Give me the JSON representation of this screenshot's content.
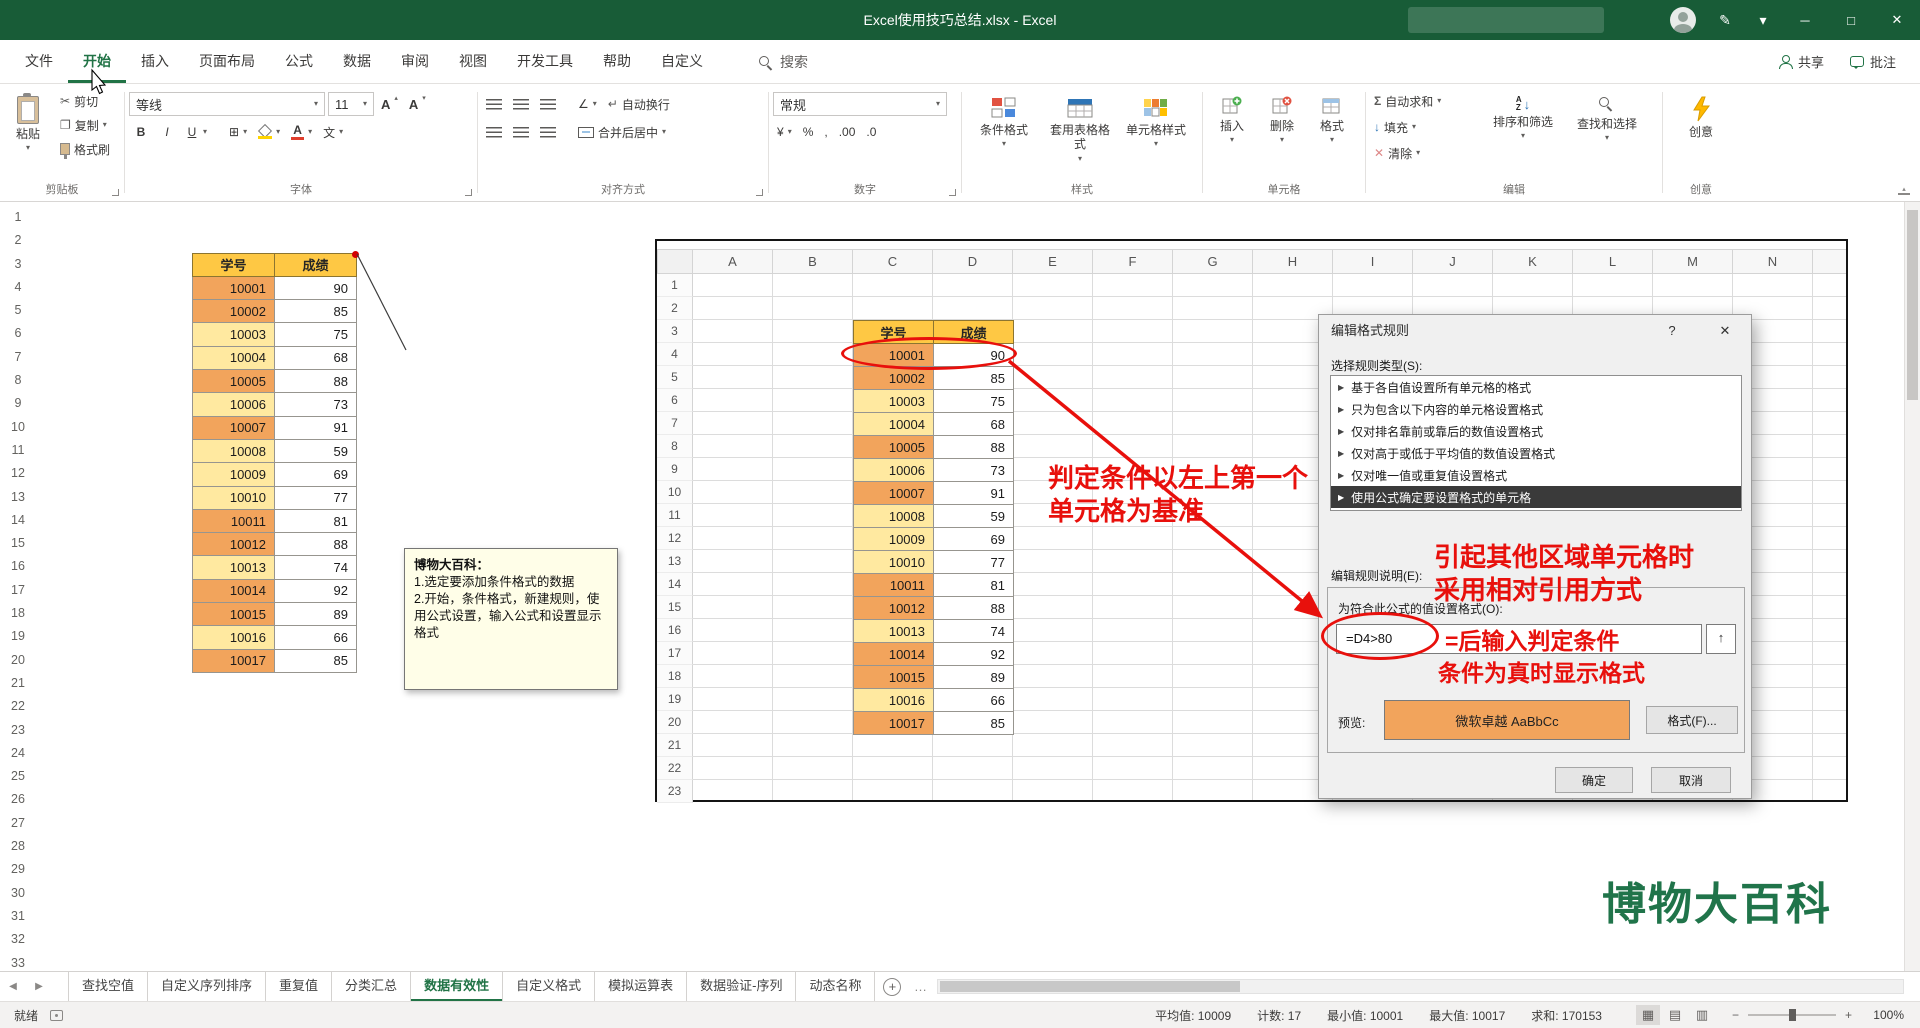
{
  "titlebar": {
    "title": "Excel使用技巧总结.xlsx - Excel"
  },
  "tabs": {
    "items": [
      "文件",
      "开始",
      "插入",
      "页面布局",
      "公式",
      "数据",
      "审阅",
      "视图",
      "开发工具",
      "帮助",
      "自定义"
    ],
    "active": "开始",
    "search_label": "搜索",
    "share_label": "共享",
    "comments_label": "批注"
  },
  "ribbon": {
    "clipboard": {
      "label": "剪贴板",
      "paste": "粘贴",
      "cut": "剪切",
      "copy": "复制",
      "format_painter": "格式刷"
    },
    "font": {
      "label": "字体",
      "font_name": "等线",
      "font_size": "11"
    },
    "alignment": {
      "label": "对齐方式",
      "wrap_text": "自动换行",
      "merge_center": "合并后居中"
    },
    "number": {
      "label": "数字",
      "format": "常规"
    },
    "styles": {
      "label": "样式",
      "conditional": "条件格式",
      "format_as_table": "套用表格格式",
      "cell_styles": "单元格样式"
    },
    "cells": {
      "label": "单元格",
      "insert": "插入",
      "delete": "删除",
      "format": "格式"
    },
    "editing": {
      "label": "编辑",
      "autosum": "自动求和",
      "fill": "填充",
      "clear": "清除",
      "sort_filter": "排序和筛选",
      "find_select": "查找和选择"
    },
    "ideas": {
      "label": "创意",
      "ideas": "创意"
    }
  },
  "sheet": {
    "rows_visible": 33,
    "table": {
      "headers": [
        "学号",
        "成绩"
      ],
      "data": [
        [
          10001,
          90
        ],
        [
          10002,
          85
        ],
        [
          10003,
          75
        ],
        [
          10004,
          68
        ],
        [
          10005,
          88
        ],
        [
          10006,
          73
        ],
        [
          10007,
          91
        ],
        [
          10008,
          59
        ],
        [
          10009,
          69
        ],
        [
          10010,
          77
        ],
        [
          10011,
          81
        ],
        [
          10012,
          88
        ],
        [
          10013,
          74
        ],
        [
          10014,
          92
        ],
        [
          10015,
          89
        ],
        [
          10016,
          66
        ],
        [
          10017,
          85
        ]
      ],
      "highlight_threshold": 80
    },
    "comment": {
      "title": "博物大百科：",
      "lines": [
        "1.选定要添加条件格式的数据",
        "2.开始，条件格式，新建规则，使用公式设置，输入公式和设置显示格式"
      ]
    }
  },
  "embedded_image": {
    "columns": [
      "A",
      "B",
      "C",
      "D",
      "E",
      "F",
      "G",
      "H",
      "I",
      "J",
      "K",
      "L",
      "M",
      "N"
    ],
    "rows_visible": 23
  },
  "dialog": {
    "title": "编辑格式规则",
    "rule_type_label": "选择规则类型(S):",
    "rule_types": [
      "基于各自值设置所有单元格的格式",
      "只为包含以下内容的单元格设置格式",
      "仅对排名靠前或靠后的数值设置格式",
      "仅对高于或低于平均值的数值设置格式",
      "仅对唯一值或重复值设置格式",
      "使用公式确定要设置格式的单元格"
    ],
    "selected_rule_index": 5,
    "edit_desc_label": "编辑规则说明(E):",
    "formula_label": "为符合此公式的值设置格式(O):",
    "formula_value": "=D4>80",
    "preview_label": "预览:",
    "preview_text": "微软卓越 AaBbCc",
    "format_button": "格式(F)...",
    "ok_button": "确定",
    "cancel_button": "取消"
  },
  "annotations": {
    "note_base_line1": "判定条件以左上第一个",
    "note_base_line2": "单元格为基准",
    "note_relative_line1": "引起其他区域单元格时",
    "note_relative_line2": "采用相对引用方式",
    "note_formula": "=后输入判定条件",
    "note_format": "条件为真时显示格式",
    "watermark": "博物大百科"
  },
  "sheet_tabs": {
    "items": [
      "查找空值",
      "自定义序列排序",
      "重复值",
      "分类汇总",
      "数据有效性",
      "自定义格式",
      "模拟运算表",
      "数据验证-序列",
      "动态名称"
    ],
    "active": "数据有效性"
  },
  "status_bar": {
    "ready": "就绪",
    "stats": [
      "平均值: 10009",
      "计数: 17",
      "最小值: 10001",
      "最大值: 10017",
      "求和: 170153"
    ],
    "zoom": "100%"
  },
  "icons": {
    "minimize": "─",
    "maximize": "□",
    "close": "✕",
    "pen": "✎",
    "ribbon_options": "▾",
    "caret": "▾",
    "caret_up": "▴",
    "letter_a": "A",
    "cut": "✂",
    "copy": "❐",
    "bold": "B",
    "italic": "I",
    "underline": "U",
    "borders": "⊞",
    "phonetic": "文",
    "wrap": "↵",
    "orientation": "∠",
    "currency": "¥",
    "percent": "%",
    "comma": ",",
    "inc_decimal": ".00",
    "dec_decimal": ".0",
    "autosum": "Σ",
    "fill": "↓",
    "clear": "✕",
    "sort_a": "A",
    "sort_z": "Z",
    "arrow_down": "↓",
    "range_select": "↑",
    "help": "?",
    "rule_marker": "▶",
    "tab_prev": "◀",
    "tab_next": "▶",
    "new_sheet": "+",
    "more": "…",
    "view_normal": "▦",
    "view_layout": "▤",
    "view_break": "▥",
    "zoom_minus": "−",
    "zoom_plus": "+"
  },
  "colors": {
    "title_green": "#185c37",
    "excel_green": "#217346",
    "header_fill": "#fec844",
    "cell_light": "#ffe9a0",
    "cell_highlight": "#f2a45c",
    "annotation_red": "#e8100c"
  }
}
